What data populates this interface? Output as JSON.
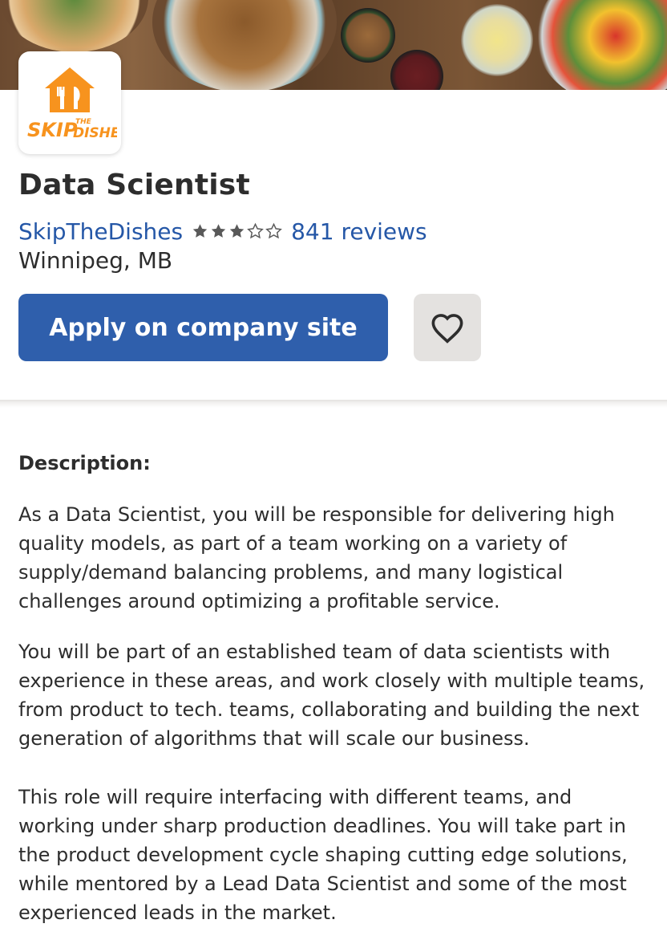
{
  "job": {
    "title": "Data Scientist",
    "company": "SkipTheDishes",
    "rating": 3,
    "rating_max": 5,
    "reviews": "841 reviews",
    "location": "Winnipeg, MB"
  },
  "logo": {
    "brand_line1": "SKIP",
    "brand_small": "THE",
    "brand_line2": "DISHES",
    "color": "#f7931e"
  },
  "actions": {
    "apply_label": "Apply on company site",
    "save_icon": "heart-icon"
  },
  "description": {
    "heading": "Description:",
    "paragraphs": [
      "As a Data Scientist, you will be responsible for delivering high quality models, as part of a team working on a variety of supply/demand balancing problems, and many logistical challenges around optimizing a profitable service.",
      "You will be part of an established team of data scientists with experience in these areas, and work closely with multiple teams, from product to tech. teams, collaborating and building the next generation of algorithms that will scale our business.",
      "This role will require interfacing with different teams, and working under sharp production deadlines. You will take part in the product development cycle shaping cutting edge solutions, while mentored by a Lead Data Scientist and some of the most experienced leads in the market."
    ]
  },
  "colors": {
    "accent": "#2557a7",
    "button": "#2f5fac",
    "text": "#2d2d2d"
  }
}
